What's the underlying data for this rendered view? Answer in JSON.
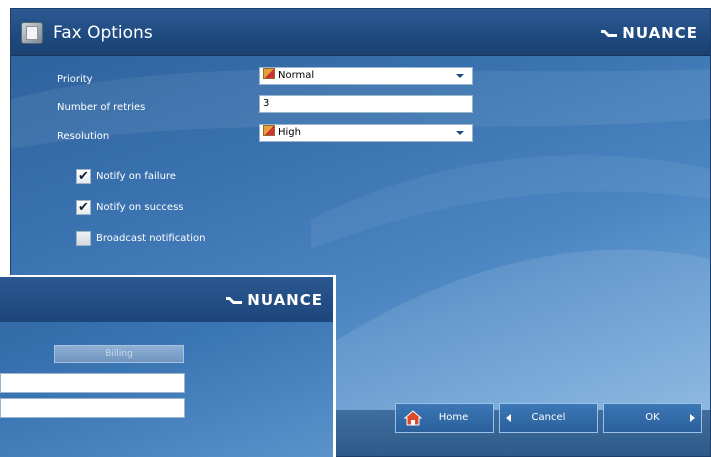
{
  "window": {
    "title": "Fax Options",
    "brand": "NUANCE"
  },
  "form": {
    "priority_label": "Priority",
    "priority_value": "Normal",
    "retries_label": "Number of retries",
    "retries_value": "3",
    "resolution_label": "Resolution",
    "resolution_value": "High"
  },
  "checks": [
    {
      "label": "Notify on failure",
      "checked": true
    },
    {
      "label": "Notify on success",
      "checked": true
    },
    {
      "label": "Broadcast notification",
      "checked": false
    }
  ],
  "footer": {
    "home_label": "Home",
    "cancel_label": "Cancel",
    "ok_label": "OK"
  },
  "overlay": {
    "brand": "NUANCE",
    "billing_label": "Billing"
  },
  "colors": {
    "accent": "#2c5a92",
    "check_mark": "#123456"
  }
}
